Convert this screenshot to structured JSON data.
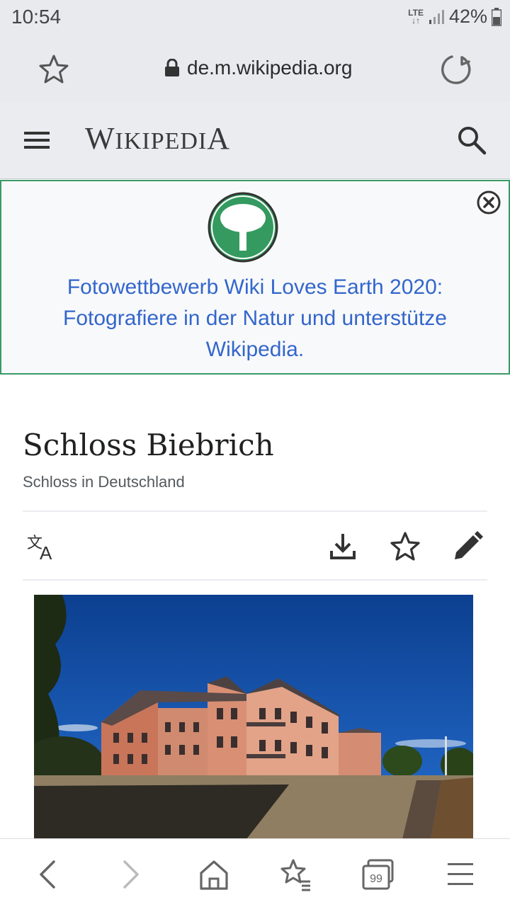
{
  "status_bar": {
    "time": "10:54",
    "network": "LTE",
    "battery": "42%"
  },
  "browser": {
    "url": "de.m.wikipedia.org",
    "tabs_count": "99"
  },
  "wiki_header": {
    "logo_text_first": "W",
    "logo_text_small": "IKIPEDI",
    "logo_text_last": "A"
  },
  "banner": {
    "line1": "Fotowettbewerb Wiki Loves Earth 2020:",
    "line2": "Fotografiere in der Natur und unterstütze",
    "line3": "Wikipedia.",
    "color": "#3366cc",
    "border_color": "#3a9a67"
  },
  "article": {
    "title": "Schloss Biebrich",
    "description": "Schloss in Deutschland"
  },
  "icons": {
    "address_bar": [
      "star-icon",
      "lock-icon",
      "reload-icon"
    ],
    "wiki_header": [
      "menu-icon",
      "search-icon"
    ],
    "page_actions": [
      "language-icon",
      "download-icon",
      "watch-star-icon",
      "edit-pencil-icon"
    ],
    "bottom_nav": [
      "back-icon",
      "forward-icon",
      "home-icon",
      "bookmarks-icon",
      "tabs-icon",
      "menu-icon"
    ]
  }
}
